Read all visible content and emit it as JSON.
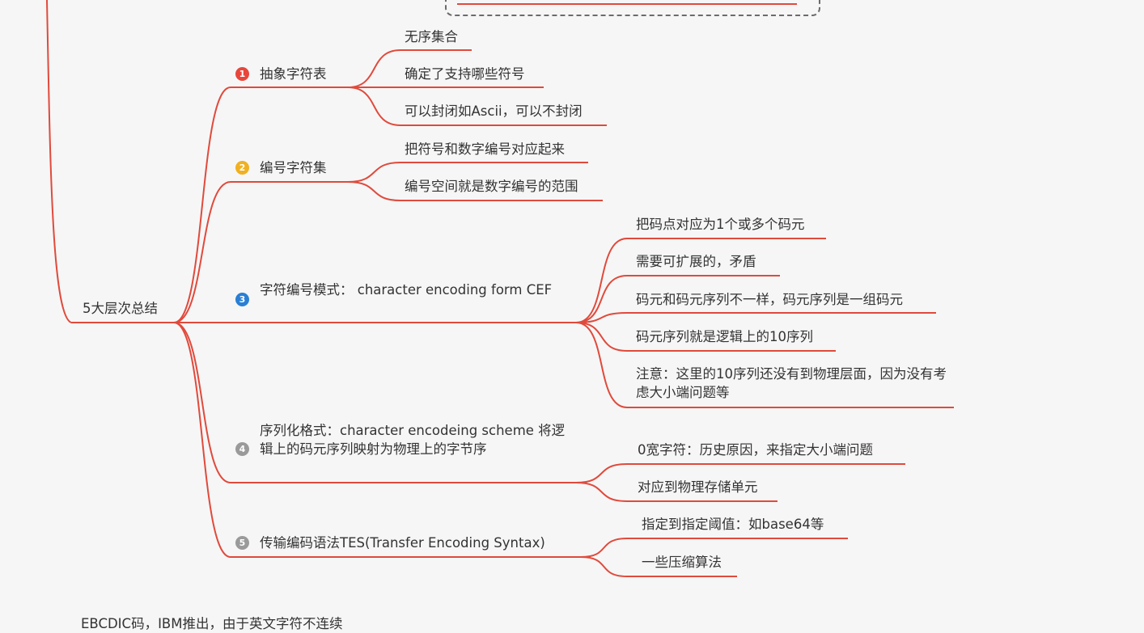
{
  "colors": {
    "line": "#e04a3c",
    "badge1": "#e8463b",
    "badge2": "#f0b020",
    "badge3": "#2a7fd4",
    "badge4": "#9a9a9a",
    "badge5": "#9a9a9a"
  },
  "root": {
    "label": "5大层次总结"
  },
  "branches": [
    {
      "badge": "1",
      "label": "抽象字符表",
      "children": [
        "无序集合",
        "确定了支持哪些符号",
        "可以封闭如Ascii，可以不封闭"
      ]
    },
    {
      "badge": "2",
      "label": "编号字符集",
      "children": [
        "把符号和数字编号对应起来",
        "编号空间就是数字编号的范围"
      ]
    },
    {
      "badge": "3",
      "label": " 字符编号模式： character encoding form CEF",
      "children": [
        "把码点对应为1个或多个码元",
        " 需要可扩展的，矛盾",
        "码元和码元序列不一样，码元序列是一组码元",
        "码元序列就是逻辑上的10序列",
        "注意：这里的10序列还没有到物理层面，因为没有考虑大小端问题等"
      ]
    },
    {
      "badge": "4",
      "label": "序列化格式：character encodeing scheme    将逻辑上的码元序列映射为物理上的字节序",
      "children": [
        "0宽字符：历史原因，来指定大小端问题",
        "对应到物理存储单元"
      ]
    },
    {
      "badge": "5",
      "label": " 传输编码语法TES(Transfer Encoding Syntax)",
      "children": [
        "指定到指定阈值：如base64等",
        "一些压缩算法"
      ]
    }
  ],
  "footer_cut_text": "EBCDIC码，IBM推出，由于英文字符不连续"
}
